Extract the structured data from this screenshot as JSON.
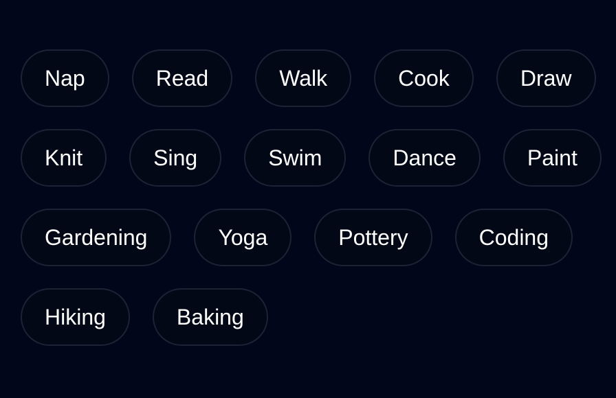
{
  "chips": {
    "row1": [
      "Nap",
      "Read",
      "Walk",
      "Cook",
      "Draw"
    ],
    "row2": [
      "Knit",
      "Sing",
      "Swim",
      "Dance",
      "Paint"
    ],
    "row3": [
      "Gardening",
      "Yoga",
      "Pottery",
      "Coding"
    ],
    "row4": [
      "Hiking",
      "Baking"
    ]
  },
  "colors": {
    "background": "#02061a",
    "chip_border": "#1b2334",
    "chip_text": "#ffffff"
  }
}
